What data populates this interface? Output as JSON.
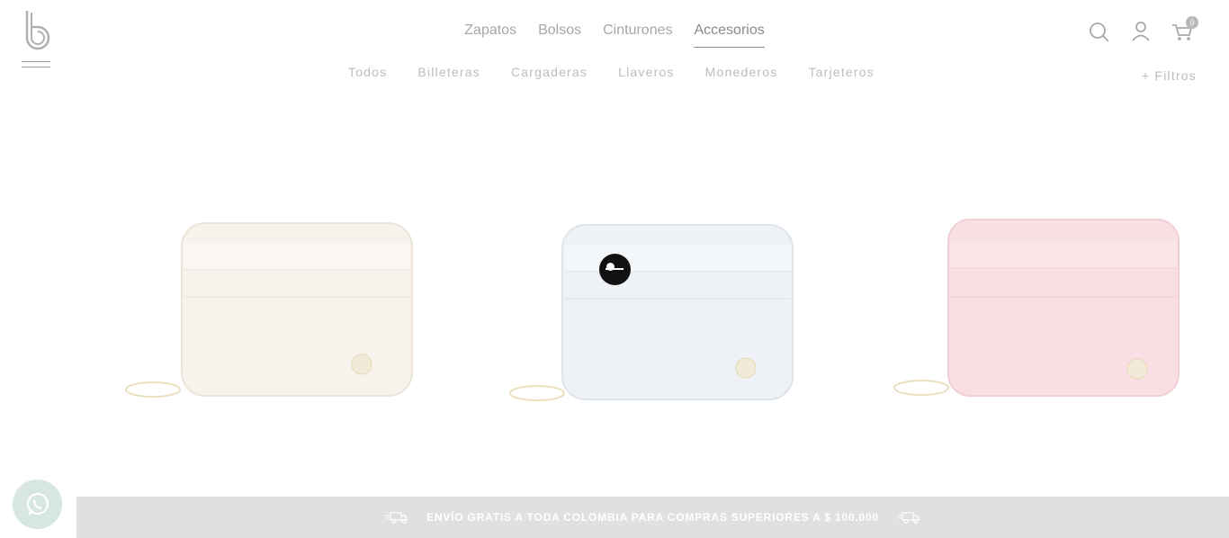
{
  "logo": {
    "letter": "b"
  },
  "main_nav": [
    {
      "label": "Zapatos",
      "active": false
    },
    {
      "label": "Bolsos",
      "active": false
    },
    {
      "label": "Cinturones",
      "active": false
    },
    {
      "label": "Accesorios",
      "active": true
    }
  ],
  "sub_nav": [
    "Todos",
    "Billeteras",
    "Cargaderas",
    "Llaveros",
    "Monederos",
    "Tarjeteros"
  ],
  "filters": {
    "label": "+ Filtros"
  },
  "header_icons": {
    "search": "search-icon",
    "account": "user-icon",
    "cart": "cart-icon",
    "cart_count": "0"
  },
  "products": [
    {
      "color": "#f7f2ec",
      "accent": "#efe7dd"
    },
    {
      "color": "#eef2f6",
      "accent": "#e3e8ee"
    },
    {
      "color": "#f9dfe3",
      "accent": "#f2cfd5"
    }
  ],
  "promo": {
    "text": "ENVÍO GRATIS A TODA COLOMBIA PARA COMPRAS SUPERIORES A $ 100.000"
  },
  "colors": {
    "promo_bg": "#e0e0e0",
    "whatsapp_bg": "#d7e6df"
  }
}
